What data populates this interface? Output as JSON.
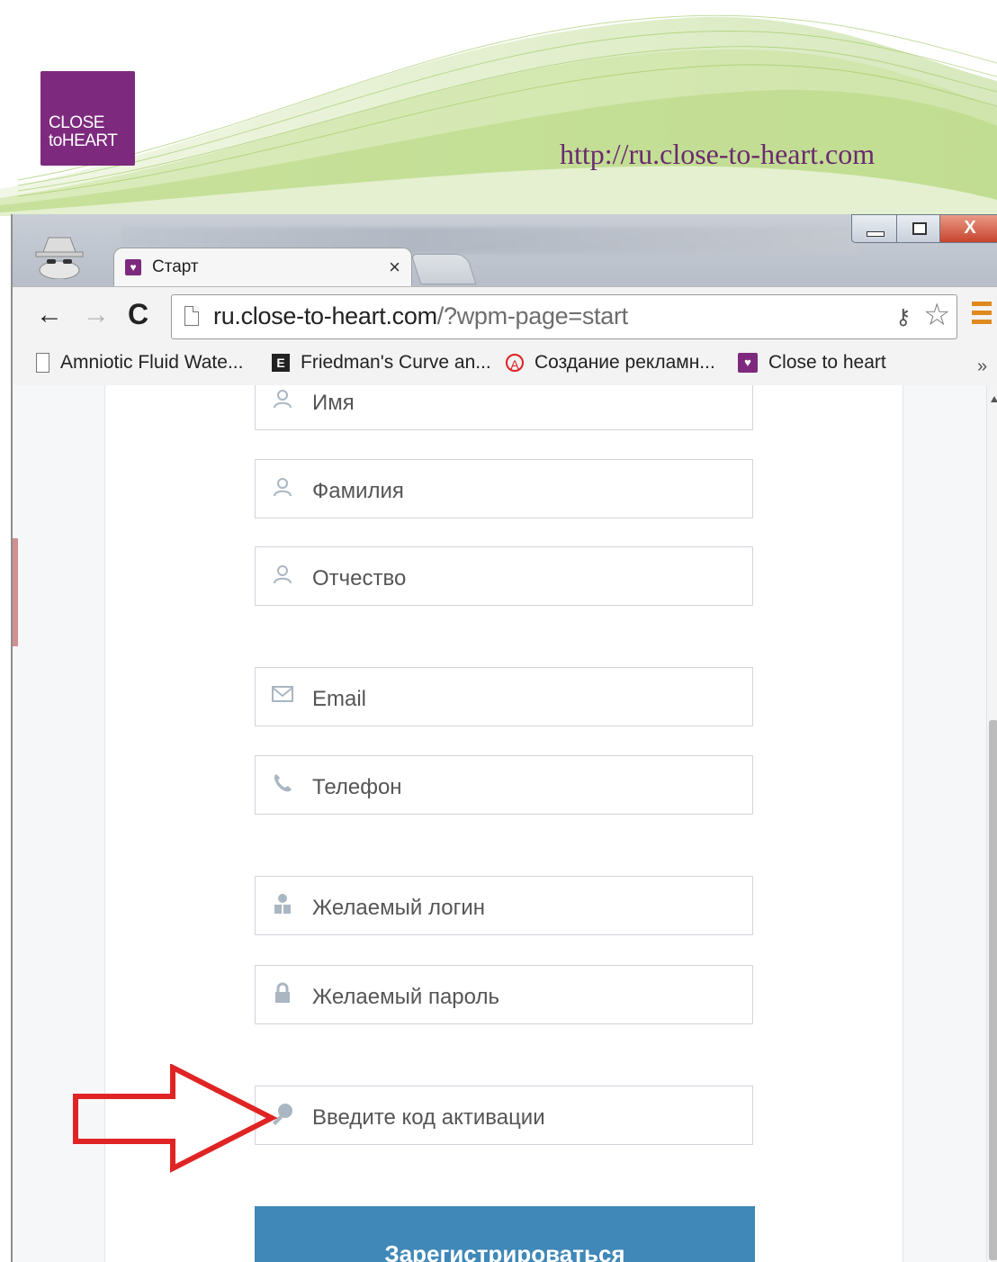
{
  "banner": {
    "logo_line1": "CLOSE",
    "logo_line2": "toHEART",
    "url": "http://ru.close-to-heart.com"
  },
  "browser": {
    "tab_title": "Старт",
    "tab_close": "×",
    "address": {
      "host": "ru.close-to-heart.com",
      "path": "/?wpm-page=start"
    },
    "bookmarks": [
      {
        "label": "Amniotic Fluid Wate...",
        "icon": "page-icon"
      },
      {
        "label": "Friedman's Curve an...",
        "icon": "e-icon"
      },
      {
        "label": "Создание рекламн...",
        "icon": "adv-icon"
      },
      {
        "label": "Close to heart",
        "icon": "heart-icon"
      }
    ],
    "bookmarks_more": "»",
    "window_close": "X"
  },
  "form": {
    "fields": [
      {
        "label": "Имя",
        "icon": "user-outline-icon"
      },
      {
        "label": "Фамилия",
        "icon": "user-outline-icon"
      },
      {
        "label": "Отчество",
        "icon": "user-outline-icon"
      },
      {
        "label": "Email",
        "icon": "envelope-icon"
      },
      {
        "label": "Телефон",
        "icon": "phone-icon"
      },
      {
        "label": "Желаемый логин",
        "icon": "user-solid-icon"
      },
      {
        "label": "Желаемый пароль",
        "icon": "lock-icon"
      },
      {
        "label": "Введите код активации",
        "icon": "key-icon"
      }
    ],
    "submit_label": "Зарегистрироваться"
  },
  "colors": {
    "brand_purple": "#7d2a7e",
    "submit_blue": "#3f88b8",
    "annotation_red": "#e02424"
  }
}
